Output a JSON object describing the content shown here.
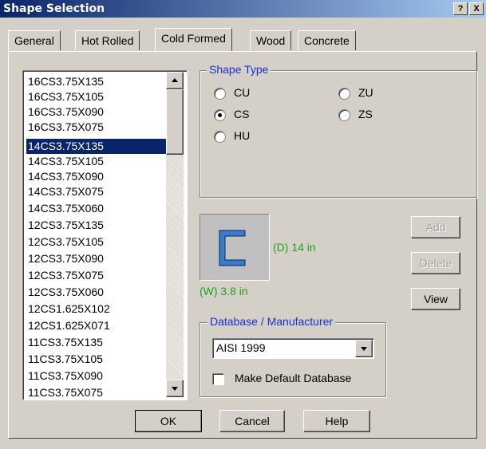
{
  "window": {
    "title": "Shape Selection",
    "help_btn": "?",
    "close_btn": "X"
  },
  "tabs": [
    {
      "label": "General",
      "active": false
    },
    {
      "label": "Hot Rolled",
      "active": false
    },
    {
      "label": "Cold Formed",
      "active": true
    },
    {
      "label": "Wood",
      "active": false
    },
    {
      "label": "Concrete",
      "active": false
    }
  ],
  "shape_list": {
    "items": [
      "16CS3.75X135",
      "16CS3.75X105",
      "16CS3.75X090",
      "16CS3.75X075",
      "14CS3.75X135",
      "14CS3.75X105",
      "14CS3.75X090",
      "14CS3.75X075",
      "14CS3.75X060",
      "12CS3.75X135",
      "12CS3.75X105",
      "12CS3.75X090",
      "12CS3.75X075",
      "12CS3.75X060",
      "12CS1.625X102",
      "12CS1.625X071",
      "11CS3.75X135",
      "11CS3.75X105",
      "11CS3.75X090",
      "11CS3.75X075"
    ],
    "selected_index": 4
  },
  "shape_type": {
    "title": "Shape Type",
    "options": [
      {
        "label": "CU",
        "selected": false
      },
      {
        "label": "CS",
        "selected": true
      },
      {
        "label": "HU",
        "selected": false
      },
      {
        "label": "ZU",
        "selected": false
      },
      {
        "label": "ZS",
        "selected": false
      }
    ]
  },
  "preview": {
    "depth_label": "(D) 14 in",
    "width_label": "(W) 3.8 in",
    "shape_color": "#3a7bc8"
  },
  "actions": {
    "add": "Add",
    "delete": "Delete",
    "view": "View"
  },
  "database": {
    "title": "Database / Manufacturer",
    "selected": "AISI 1999",
    "default_checkbox_label": "Make Default Database",
    "default_checked": false
  },
  "footer": {
    "ok": "OK",
    "cancel": "Cancel",
    "help": "Help"
  }
}
